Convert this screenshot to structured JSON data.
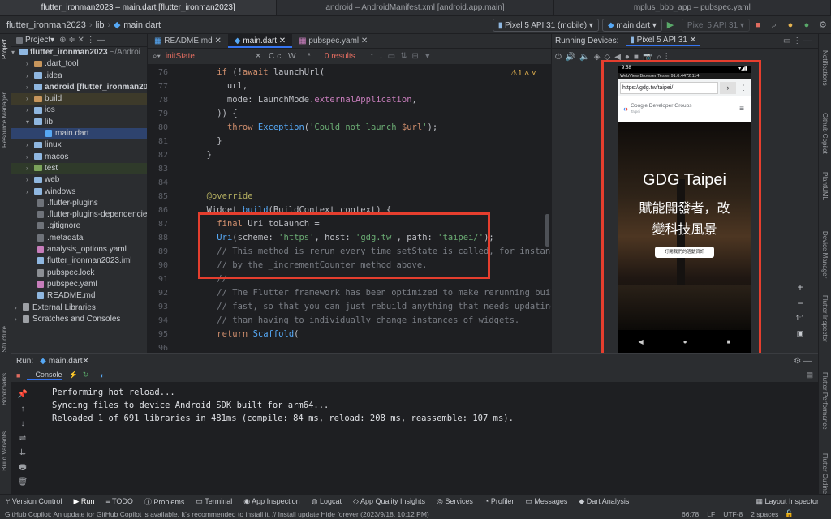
{
  "window_tabs": [
    "flutter_ironman2023 – main.dart [flutter_ironman2023]",
    "android – AndroidManifest.xml [android.app.main]",
    "mplus_bbb_app – pubspec.yaml"
  ],
  "breadcrumb": [
    "flutter_ironman2023",
    "lib",
    "main.dart"
  ],
  "toolbar": {
    "device": "Pixel 5 API 31 (mobile)",
    "config": "main.dart",
    "device2": "Pixel 5 API 31"
  },
  "project": {
    "title": "Project",
    "root": "flutter_ironman2023",
    "root_path": "~/Androi",
    "items": [
      ".dart_tool",
      ".idea",
      "android [flutter_ironman2023]",
      "build",
      "ios",
      "lib",
      "main.dart",
      "linux",
      "macos",
      "test",
      "web",
      "windows",
      ".flutter-plugins",
      ".flutter-plugins-dependencie",
      ".gitignore",
      ".metadata",
      "analysis_options.yaml",
      "flutter_ironman2023.iml",
      "pubspec.lock",
      "pubspec.yaml",
      "README.md",
      "External Libraries",
      "Scratches and Consoles"
    ]
  },
  "editor": {
    "tabs": [
      "README.md",
      "main.dart",
      "pubspec.yaml"
    ],
    "find_value": "initState",
    "find_results": "0 results",
    "warning_count": "1",
    "line_numbers": [
      "76",
      "77",
      "78",
      "79",
      "80",
      "81",
      "82",
      "83",
      "84",
      "85",
      "86",
      "87",
      "88",
      "89",
      "90",
      "91",
      "92",
      "93",
      "94",
      "95",
      "96"
    ]
  },
  "devices": {
    "title": "Running Devices:",
    "tab": "Pixel 5 API 31"
  },
  "phone": {
    "time": "9:58",
    "webview_title": "WebView Browser Tester 91.0.4472.114",
    "url": "https://gdg.tw/taipei/",
    "site_name": "Google Developer Groups",
    "site_sub": "Taipei",
    "hero_title": "GDG Taipei",
    "hero_line1": "賦能開發者，改",
    "hero_line2": "變科技風景",
    "cta": "訂閱我們的活動資訊",
    "zoom_ratio": "1:1"
  },
  "run": {
    "label": "Run:",
    "config": "main.dart",
    "console_tab": "Console",
    "output": [
      "Performing hot reload...",
      "Syncing files to device Android SDK built for arm64...",
      "Reloaded 1 of 691 libraries in 481ms (compile: 84 ms, reload: 208 ms, reassemble: 107 ms)."
    ]
  },
  "left_tools": [
    "Project",
    "Resource Manager",
    "Structure",
    "Bookmarks",
    "Build Variants"
  ],
  "right_tools": [
    "Notifications",
    "Github Copilot",
    "PlantUML",
    "Device Manager",
    "Flutter Inspector",
    "Flutter Performance",
    "Flutter Outline"
  ],
  "bottom_tools": [
    "Version Control",
    "Run",
    "TODO",
    "Problems",
    "Terminal",
    "App Inspection",
    "Logcat",
    "App Quality Insights",
    "Services",
    "Profiler",
    "Messages",
    "Dart Analysis",
    "Layout Inspector"
  ],
  "status": {
    "message": "GitHub Copilot: An update for GitHub Copilot is available. It's recommended to install it. // Install update   Hide forever (2023/9/18, 10:12 PM)",
    "position": "66:78",
    "line_sep": "LF",
    "encoding": "UTF-8",
    "indent": "2 spaces"
  }
}
